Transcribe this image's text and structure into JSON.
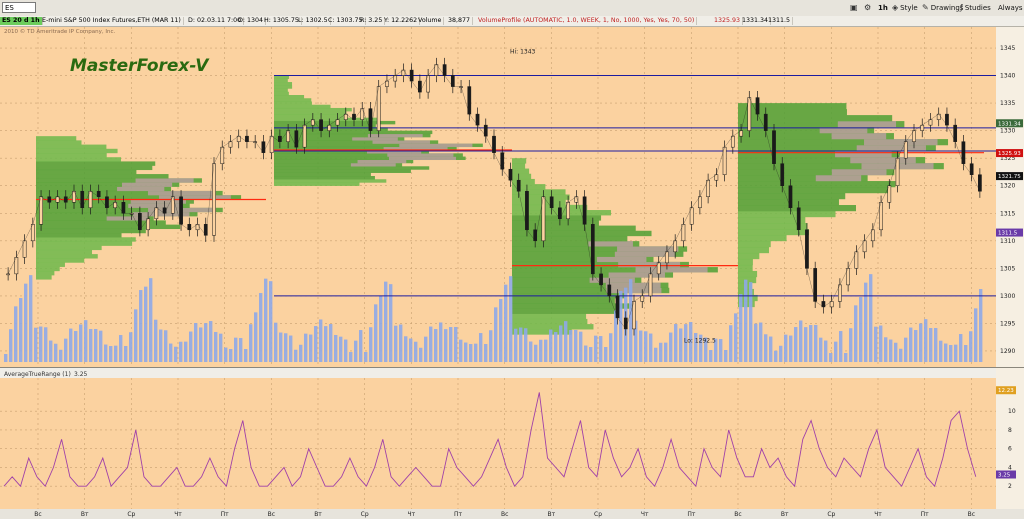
{
  "toolbar": {
    "symbol": "ES",
    "interval": "1h",
    "style_label": "Style",
    "drawings_label": "Drawings",
    "studies_label": "Studies",
    "always_label": "Always o"
  },
  "infobar": {
    "chart_id": "ES 20 d 1h",
    "instrument": "E-mini S&P 500 Index Futures,ETH (MAR 11)",
    "date": "D: 02.03.11 7:00",
    "open": "O: 1304",
    "high": "H: 1305.75",
    "low": "L: 1302.5",
    "close": "C: 1303.75",
    "range": "R: 3.25",
    "y": "Y: 12.2262",
    "volume_label": "Volume",
    "volume_value": "38,877",
    "volume_profile": "VolumeProfile (AUTOMATIC, 1.0, WEEK, 1, No, 1000, Yes, Yes, 70, 50)",
    "vp1": "1325.93",
    "vp2": "1331.34",
    "vp3": "1311.5"
  },
  "copyright": "2010 © TD Ameritrade IP Company, Inc.",
  "watermark": "MasterForex-V",
  "colors": {
    "background": "#fbd2a0",
    "green_profile": "#4ea034",
    "pink_profile": "#e59ad0",
    "volume_bars": "#8ea8e8",
    "poc_line": "#ff2a10",
    "level_line": "#1c1ca0",
    "candle": "#1a1a1a",
    "atr_line": "#a040a8"
  },
  "chart_data": {
    "type": "line",
    "title": "",
    "subtitle": "E-mini S&P 500 Index Futures,ETH (MAR 11)",
    "price_axis": {
      "ylim": [
        1288,
        1347
      ],
      "ticks": [
        "1345",
        "1340",
        "1335",
        "1330",
        "1325",
        "1320",
        "1315",
        "1310",
        "1305",
        "1300",
        "1295",
        "1290"
      ]
    },
    "x_ticks": [
      "Вс",
      "Вт",
      "Ср",
      "Чт",
      "Пт",
      "Вс",
      "Вт",
      "Ср",
      "Чт",
      "Пт",
      "Вс",
      "Вт",
      "Ср",
      "Чт",
      "Пт",
      "Вс",
      "Вт",
      "Ср",
      "Чт",
      "Пт",
      "Вс"
    ],
    "close_series": [
      1304,
      1307,
      1310,
      1313,
      1318,
      1317,
      1318,
      1317,
      1319,
      1316,
      1319,
      1318,
      1316,
      1317,
      1315,
      1315,
      1312,
      1314,
      1316,
      1315,
      1318,
      1313,
      1312,
      1313,
      1311,
      1324,
      1327,
      1328,
      1329,
      1328,
      1328,
      1326,
      1329,
      1328,
      1330,
      1327,
      1331,
      1332,
      1330,
      1331,
      1332,
      1333,
      1332,
      1334,
      1330,
      1338,
      1339,
      1340,
      1341,
      1339,
      1337,
      1340,
      1342,
      1340,
      1338,
      1338,
      1333,
      1331,
      1329,
      1326,
      1323,
      1321,
      1319,
      1312,
      1310,
      1318,
      1316,
      1314,
      1317,
      1318,
      1313,
      1304,
      1302,
      1300,
      1296,
      1294,
      1299,
      1300,
      1304,
      1306,
      1308,
      1310,
      1313,
      1316,
      1318,
      1321,
      1322,
      1327,
      1329,
      1330,
      1336,
      1333,
      1330,
      1324,
      1320,
      1316,
      1312,
      1305,
      1299,
      1298,
      1299,
      1302,
      1305,
      1308,
      1310,
      1312,
      1317,
      1320,
      1325,
      1328,
      1330,
      1331,
      1332,
      1333,
      1331,
      1328,
      1324,
      1322,
      1319
    ],
    "levels": [
      1340,
      1330.5,
      1326.3,
      1300
    ],
    "last_price": "1321.75",
    "high_annotation": "Hi: 1343",
    "low_annotation": "Lo: 1292.5",
    "price_badges": [
      "1331.34",
      "1325.93",
      "1311.5"
    ],
    "atr": {
      "name": "AverageTrueRange (1)",
      "value": "3.25",
      "ylim": [
        0,
        13
      ],
      "ticks": [
        "10",
        "8",
        "6",
        "4",
        "2"
      ],
      "badges": [
        "12.23",
        "3.25"
      ],
      "values": [
        2,
        3,
        2,
        5,
        3,
        2,
        4,
        7,
        3,
        2,
        2,
        3,
        5,
        2,
        3,
        4,
        8,
        3,
        2,
        2,
        3,
        4,
        2,
        2,
        3,
        5,
        3,
        2,
        6,
        9,
        4,
        2,
        2,
        3,
        4,
        2,
        3,
        6,
        4,
        2,
        2,
        3,
        5,
        3,
        2,
        4,
        7,
        3,
        2,
        3,
        4,
        3,
        2,
        2,
        6,
        4,
        3,
        2,
        3,
        5,
        7,
        4,
        2,
        3,
        8,
        12,
        5,
        4,
        3,
        6,
        9,
        4,
        3,
        8,
        5,
        3,
        4,
        6,
        3,
        2,
        4,
        7,
        4,
        3,
        2,
        6,
        4,
        3,
        8,
        5,
        3,
        3,
        6,
        4,
        5,
        3,
        2,
        7,
        9,
        6,
        4,
        3,
        5,
        4,
        3,
        6,
        8,
        4,
        3,
        2,
        4,
        6,
        3,
        2,
        5,
        9,
        10,
        6,
        3
      ]
    }
  }
}
